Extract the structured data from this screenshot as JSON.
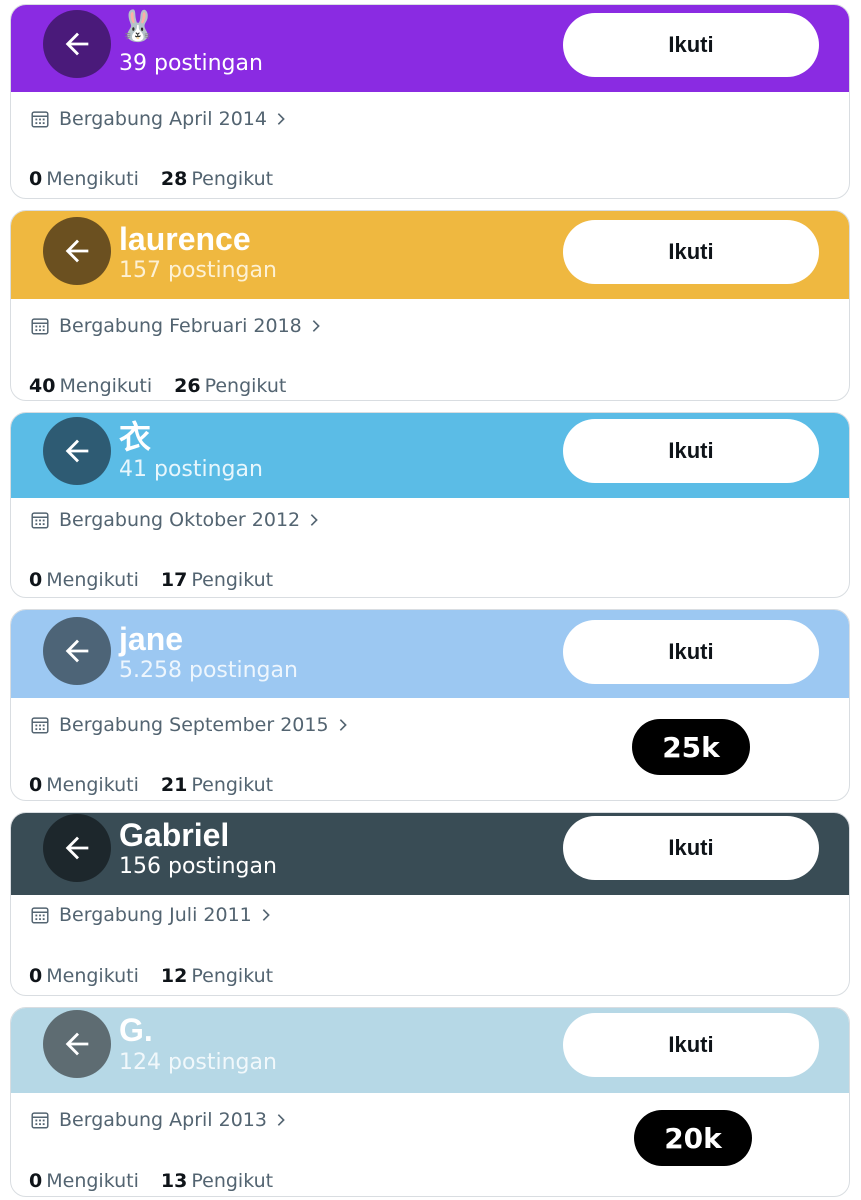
{
  "profiles": [
    {
      "name": "🐰",
      "posts": "39 postingan",
      "follow_label": "Ikuti",
      "joined": "Bergabung April 2014",
      "following_count": "0",
      "following_label": "Mengikuti",
      "followers_count": "28",
      "followers_label": "Pengikut",
      "header_color": "#8a2be2",
      "avatar_color": "#4a1a7a",
      "post_count_color": "#ffffff"
    },
    {
      "name": "laurence",
      "posts": "157 postingan",
      "follow_label": "Ikuti",
      "joined": "Bergabung Februari 2018",
      "following_count": "40",
      "following_label": "Mengikuti",
      "followers_count": "26",
      "followers_label": "Pengikut",
      "header_color": "#efb840",
      "avatar_color": "#6b5020",
      "post_count_color": "#fdf1d4"
    },
    {
      "name": "衣",
      "posts": "41 postingan",
      "follow_label": "Ikuti",
      "joined": "Bergabung Oktober 2012",
      "following_count": "0",
      "following_label": "Mengikuti",
      "followers_count": "17",
      "followers_label": "Pengikut",
      "header_color": "#5bbce6",
      "avatar_color": "#2e5b73",
      "post_count_color": "#e7f6fc"
    },
    {
      "name": "jane",
      "posts": "5.258 postingan",
      "follow_label": "Ikuti",
      "joined": "Bergabung September 2015",
      "following_count": "0",
      "following_label": "Mengikuti",
      "followers_count": "21",
      "followers_label": "Pengikut",
      "header_color": "#9cc8f2",
      "avatar_color": "#4d6477",
      "post_count_color": "#eef6fd",
      "badge": "25k"
    },
    {
      "name": "Gabriel",
      "posts": "156 postingan",
      "follow_label": "Ikuti",
      "joined": "Bergabung Juli 2011",
      "following_count": "0",
      "following_label": "Mengikuti",
      "followers_count": "12",
      "followers_label": "Pengikut",
      "header_color": "#394c55",
      "avatar_color": "#1d272c",
      "post_count_color": "#ffffff"
    },
    {
      "name": "G.",
      "posts": "124 postingan",
      "follow_label": "Ikuti",
      "joined": "Bergabung April 2013",
      "following_count": "0",
      "following_label": "Mengikuti",
      "followers_count": "13",
      "followers_label": "Pengikut",
      "header_color": "#b6d8e6",
      "avatar_color": "#5e6c72",
      "post_count_color": "#f1f8fb",
      "badge": "20k"
    }
  ],
  "icons": {
    "back": "arrow-left-icon",
    "calendar": "calendar-icon",
    "chevron": "chevron-right-icon"
  }
}
